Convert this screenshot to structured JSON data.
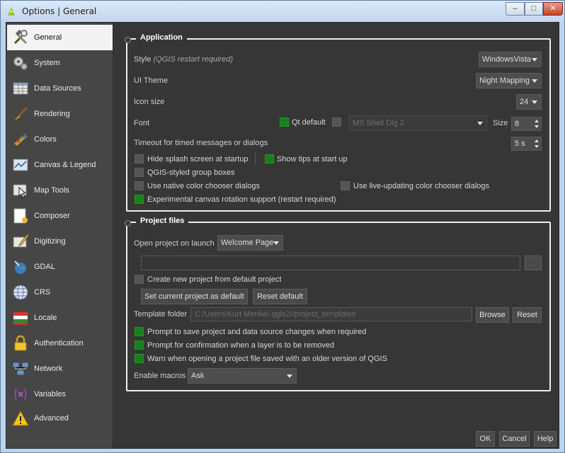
{
  "window": {
    "title": "Options | General",
    "min": "–",
    "max": "□",
    "close": "✕"
  },
  "sidebar": {
    "items": [
      {
        "label": "General",
        "icon": "tools-icon"
      },
      {
        "label": "System",
        "icon": "gears-icon"
      },
      {
        "label": "Data Sources",
        "icon": "table-icon"
      },
      {
        "label": "Rendering",
        "icon": "brush-icon"
      },
      {
        "label": "Colors",
        "icon": "palette-icon"
      },
      {
        "label": "Canvas & Legend",
        "icon": "canvas-icon"
      },
      {
        "label": "Map Tools",
        "icon": "map-tools-icon"
      },
      {
        "label": "Composer",
        "icon": "composer-icon"
      },
      {
        "label": "Digitizing",
        "icon": "digitizing-icon"
      },
      {
        "label": "GDAL",
        "icon": "gdal-icon"
      },
      {
        "label": "CRS",
        "icon": "globe-icon"
      },
      {
        "label": "Locale",
        "icon": "flag-icon"
      },
      {
        "label": "Authentication",
        "icon": "lock-icon"
      },
      {
        "label": "Network",
        "icon": "network-icon"
      },
      {
        "label": "Variables",
        "icon": "variables-icon"
      },
      {
        "label": "Advanced",
        "icon": "warning-icon"
      }
    ]
  },
  "application": {
    "title": "Application",
    "style_label": "Style",
    "style_note": "(QGIS restart required)",
    "style_value": "WindowsVista",
    "theme_label": "UI Theme",
    "theme_value": "Night Mapping",
    "icon_size_label": "Icon size",
    "icon_size_value": "24",
    "font_label": "Font",
    "qt_default_label": "Qt default",
    "font_family_value": "MS Shell Dlg 2",
    "size_label": "Size",
    "size_value": "8",
    "timeout_label": "Timeout for timed messages or dialogs",
    "timeout_value": "5 s",
    "hide_splash": "Hide splash screen at startup",
    "show_tips": "Show tips at start up",
    "group_boxes": "QGIS-styled group boxes",
    "native_color": "Use native color chooser dialogs",
    "live_color": "Use live-updating color chooser dialogs",
    "canvas_rotation": "Experimental canvas rotation support (restart required)"
  },
  "project": {
    "title": "Project files",
    "open_label": "Open project on launch",
    "open_value": "Welcome Page",
    "browse_small": "...",
    "create_default": "Create new project from default project",
    "set_default": "Set current project as default",
    "reset_default": "Reset default",
    "template_label": "Template folder",
    "template_value": "C:/Users/Kurt Menke/.qgis2//project_templates",
    "browse": "Browse",
    "reset": "Reset",
    "prompt_save": "Prompt to save project and data source changes when required",
    "prompt_remove": "Prompt for confirmation when a layer is to be removed",
    "warn_old": "Warn when opening a project file saved with an older version of QGIS",
    "macros_label": "Enable macros",
    "macros_value": "Ask"
  },
  "footer": {
    "ok": "OK",
    "cancel": "Cancel",
    "help": "Help"
  }
}
